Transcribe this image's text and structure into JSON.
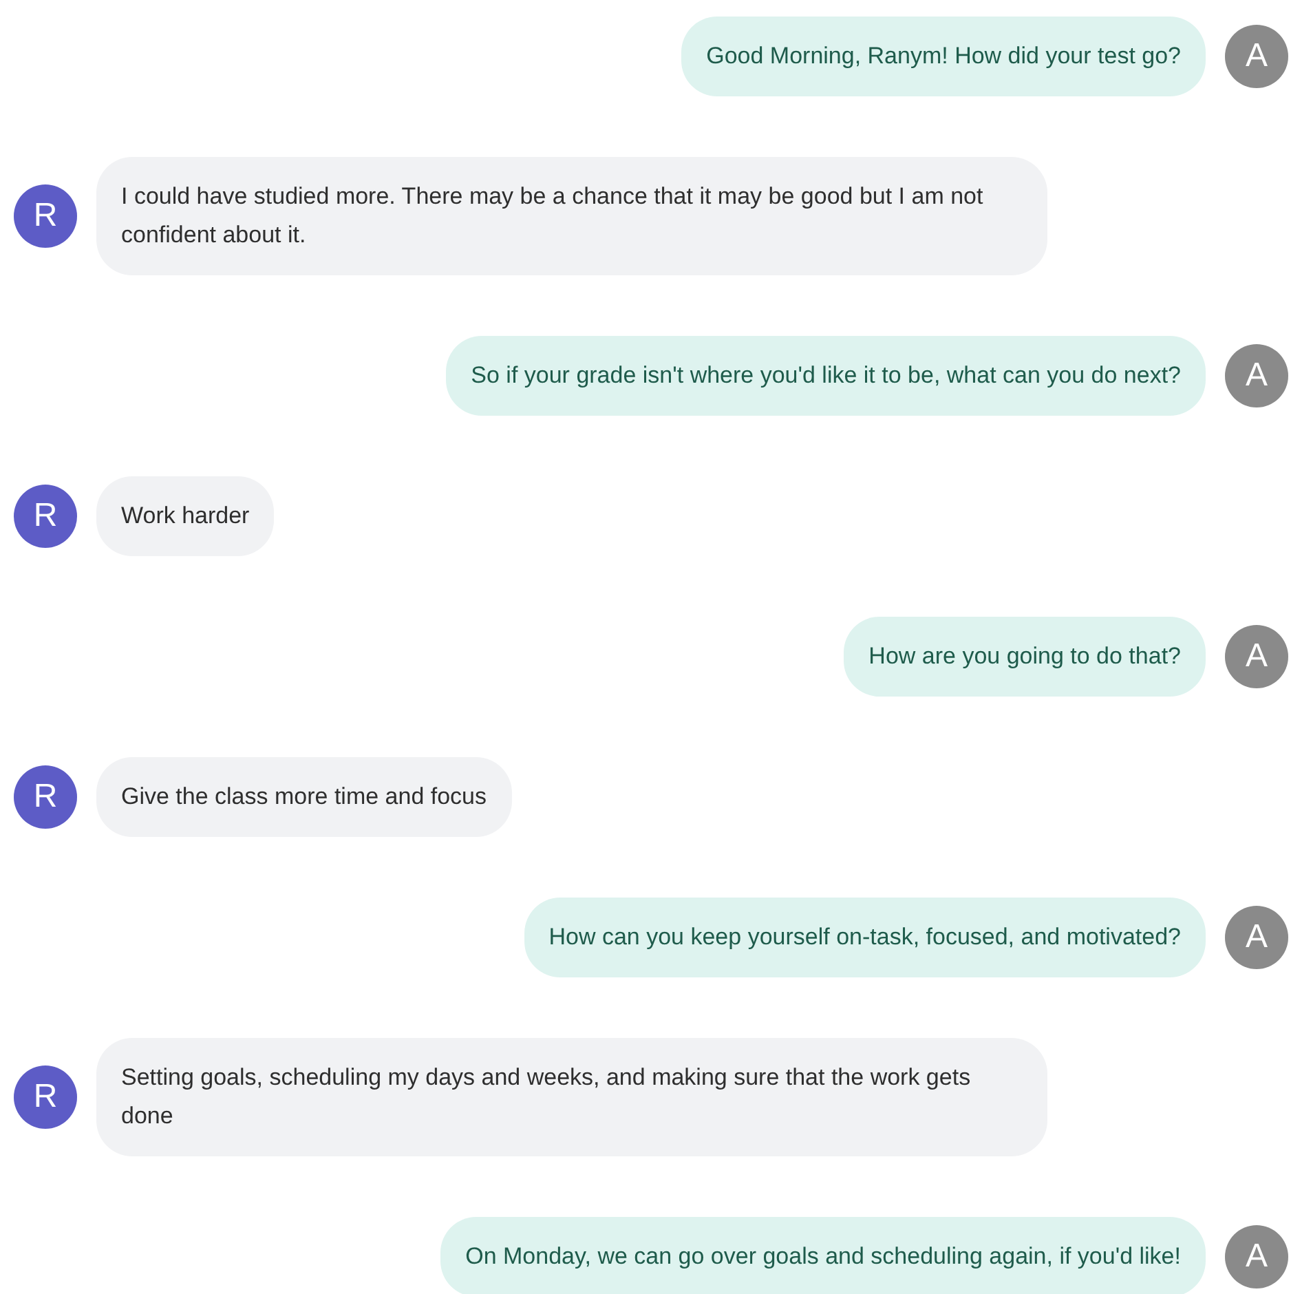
{
  "messages": [
    {
      "kind": "sent",
      "text": "Good Morning, Ranym! How did your test go?",
      "avatar": "A"
    },
    {
      "kind": "received",
      "text": "I could have studied more. There may be a chance that it may be good but I am not confident about it.",
      "avatar": "R"
    },
    {
      "kind": "sent",
      "text": "So if your grade isn't where you'd like it to be, what can you do next?",
      "avatar": "A"
    },
    {
      "kind": "received",
      "text": "Work harder",
      "avatar": "R"
    },
    {
      "kind": "sent",
      "text": "How are you going to do that?",
      "avatar": "A"
    },
    {
      "kind": "received",
      "text": "Give the class more time and focus",
      "avatar": "R"
    },
    {
      "kind": "sent",
      "text": "How can you keep yourself on-task, focused, and motivated?",
      "avatar": "A"
    },
    {
      "kind": "received",
      "text": "Setting goals, scheduling my days and weeks, and making sure that the work gets done",
      "avatar": "R"
    },
    {
      "kind": "sent",
      "text": "On Monday, we can go over goals and scheduling again, if you'd like!",
      "avatar": "A"
    }
  ]
}
